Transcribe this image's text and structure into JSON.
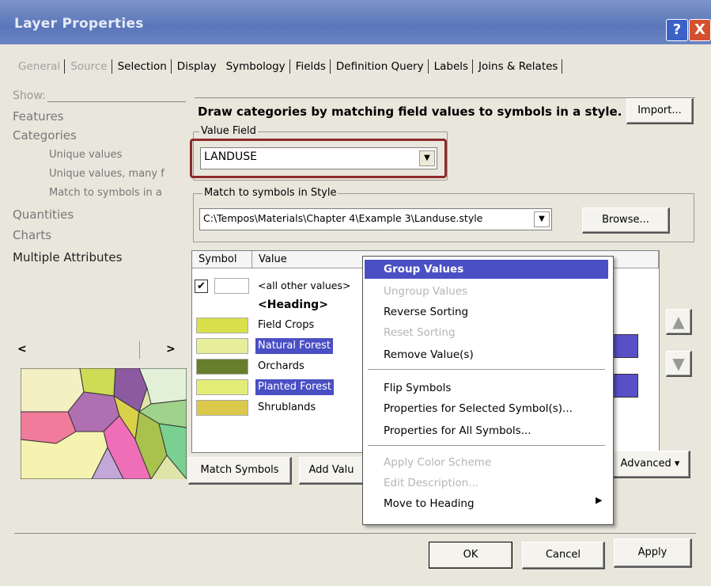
{
  "window": {
    "title": "Layer Properties",
    "help_label": "?",
    "close_label": "X"
  },
  "tabs": [
    {
      "label": "General",
      "state": "disabled"
    },
    {
      "label": "Source",
      "state": "disabled"
    },
    {
      "label": "Selection",
      "state": "normal"
    },
    {
      "label": "Display",
      "state": "normal"
    },
    {
      "label": "Symbology",
      "state": "active"
    },
    {
      "label": "Fields",
      "state": "normal"
    },
    {
      "label": "Definition Query",
      "state": "normal"
    },
    {
      "label": "Labels",
      "state": "normal"
    },
    {
      "label": "Joins & Relates",
      "state": "normal"
    }
  ],
  "show_panel": {
    "label": "Show:",
    "features": "Features",
    "categories": "Categories",
    "unique_values": "Unique values",
    "unique_values_many": "Unique values, many f",
    "match_to_symbols": "Match to symbols in a",
    "quantities": "Quantities",
    "charts": "Charts",
    "multiple_attributes": "Multiple Attributes",
    "scroll_left": "<",
    "scroll_right": ">"
  },
  "symbology": {
    "heading": "Draw categories by matching field values to symbols in a style.",
    "import_label": "Import...",
    "value_field_label": "Value Field",
    "value_field_value": "LANDUSE",
    "match_style_label": "Match to symbols in Style",
    "style_path": "C:\\Tempos\\Materials\\Chapter 4\\Example 3\\Landuse.style",
    "browse_label": "Browse...",
    "col_symbol": "Symbol",
    "col_value": "Value",
    "rows": [
      {
        "value": "<all other values>",
        "checked": true,
        "color": "#ffffff",
        "selected": false
      },
      {
        "value": "<Heading>",
        "heading": true,
        "color": "",
        "selected": false
      },
      {
        "value": "Field Crops",
        "color": "#d9e04a",
        "selected": false
      },
      {
        "value": "Natural Forest",
        "color": "#e6ee9a",
        "selected": true
      },
      {
        "value": "Orchards",
        "color": "#677e2c",
        "selected": false
      },
      {
        "value": "Planted Forest",
        "color": "#e4ec78",
        "selected": true
      },
      {
        "value": "Shrublands",
        "color": "#dcc84a",
        "selected": false
      }
    ],
    "match_symbols_label": "Match Symbols",
    "add_values_label": "Add Valu",
    "advanced_label": "Advanced"
  },
  "context_menu": {
    "items": [
      {
        "label": "Group Values",
        "state": "highlighted"
      },
      {
        "label": "Ungroup Values",
        "state": "disabled"
      },
      {
        "label": "Reverse Sorting",
        "state": "normal"
      },
      {
        "label": "Reset Sorting",
        "state": "disabled"
      },
      {
        "label": "Remove Value(s)",
        "state": "normal"
      },
      {
        "label": "Flip Symbols",
        "state": "normal"
      },
      {
        "label": "Properties for Selected Symbol(s)...",
        "state": "normal"
      },
      {
        "label": "Properties for All Symbols...",
        "state": "normal"
      },
      {
        "label": "Apply Color Scheme",
        "state": "disabled"
      },
      {
        "label": "Edit Description...",
        "state": "disabled"
      },
      {
        "label": "Move to Heading",
        "state": "normal",
        "submenu": true
      }
    ]
  },
  "footer": {
    "ok_label": "OK",
    "cancel_label": "Cancel",
    "apply_label": "Apply"
  },
  "colors": {
    "titlebar": "#5a76b9",
    "selection": "#4a4fc4",
    "highlight_box": "#8e2a2a"
  }
}
